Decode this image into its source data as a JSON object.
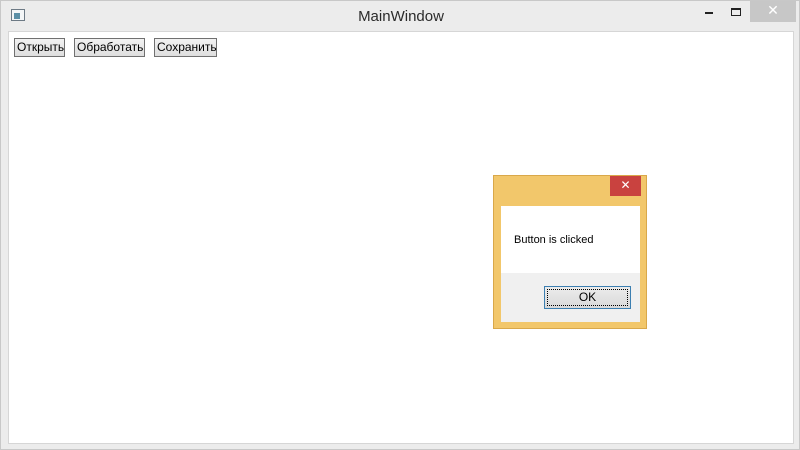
{
  "window": {
    "title": "MainWindow",
    "close_glyph": "✕",
    "icons": {
      "app": "app-window-icon",
      "minimize": "minimize-icon",
      "maximize": "maximize-icon",
      "close": "close-icon"
    }
  },
  "toolbar": {
    "open_label": "Открыть",
    "process_label": "Обработать",
    "save_label": "Сохранить"
  },
  "message_box": {
    "text": "Button is clicked",
    "ok_label": "OK",
    "close_glyph": "✕",
    "title_color": "#f2c76b",
    "close_color": "#c9423f"
  }
}
